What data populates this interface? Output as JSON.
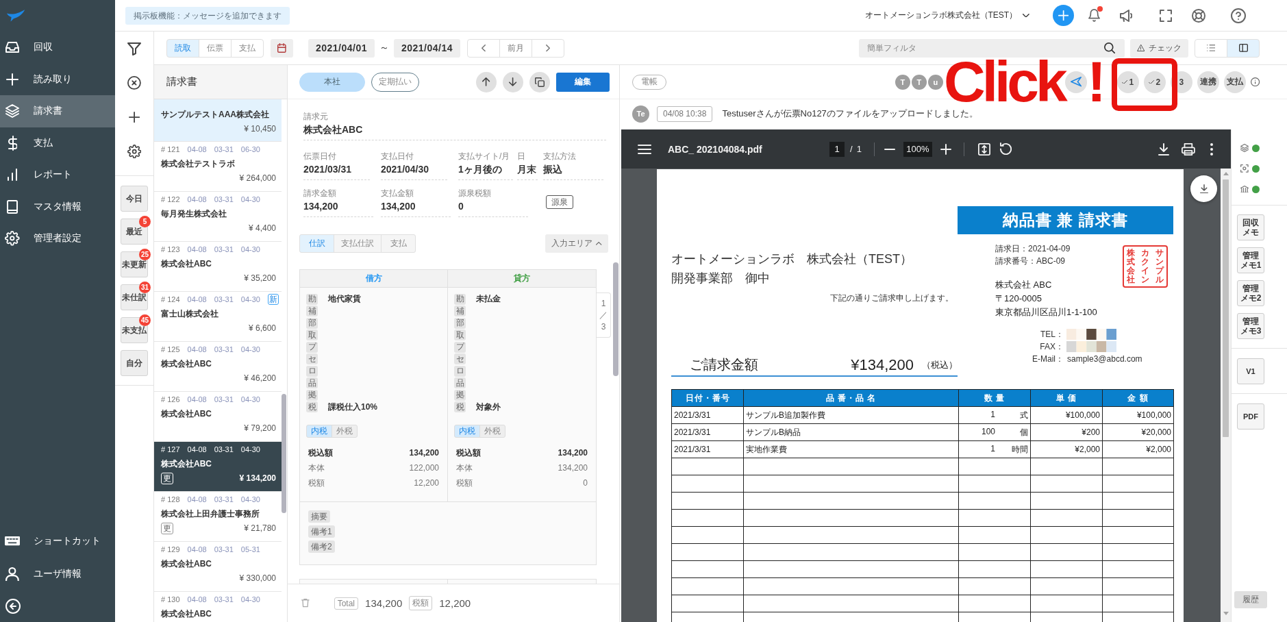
{
  "sidebar": {
    "items": [
      {
        "label": "回収",
        "selected": false
      },
      {
        "label": "読み取り",
        "selected": false
      },
      {
        "label": "請求書",
        "selected": true
      },
      {
        "label": "支払",
        "selected": false
      },
      {
        "label": "レポート",
        "selected": false
      },
      {
        "label": "マスタ情報",
        "selected": false
      },
      {
        "label": "管理者設定",
        "selected": false
      }
    ],
    "bottom_items": [
      {
        "label": "ショートカット"
      },
      {
        "label": "ユーザ情報"
      }
    ]
  },
  "top_bar": {
    "notice": "掲示板機能：メッセージを追加できます",
    "company": "オートメーションラボ株式会社（TEST）",
    "unread": true
  },
  "quick_filters": [
    {
      "label": "今日"
    },
    {
      "label": "最近",
      "count": "5"
    },
    {
      "label": "未更新",
      "count": "25"
    },
    {
      "label": "未仕訳",
      "count": "31"
    },
    {
      "label": "未支払",
      "count": "45"
    },
    {
      "label": "自分"
    }
  ],
  "toolbar": {
    "modes": [
      {
        "label": "読取",
        "selected": true
      },
      {
        "label": "伝票",
        "selected": false
      },
      {
        "label": "支払",
        "selected": false
      }
    ],
    "date_from": "2021/04/01",
    "range_separator": "～",
    "date_to": "2021/04/14",
    "month_button": "前月",
    "search": {
      "placeholder": "簡単フィルタ"
    },
    "check_button": "チェック",
    "views": [
      {
        "selected": false
      },
      {
        "selected": true
      }
    ]
  },
  "invoice_list": {
    "title": "請求書",
    "rows": [
      {
        "name": "サンプルテストAAA株式会社",
        "amount": "¥ 10,450",
        "selected": false,
        "highlighted": true
      },
      {
        "number": "# 121",
        "dates": [
          "04-08",
          "03-31",
          "06-30"
        ],
        "name": "株式会社テストラボ",
        "amount": "¥ 264,000",
        "selected": false,
        "highlighted": false
      },
      {
        "number": "# 122",
        "dates": [
          "04-08",
          "03-31",
          "04-30"
        ],
        "name": "毎月発生株式会社",
        "amount": "¥ 4,400",
        "selected": false,
        "highlighted": false
      },
      {
        "number": "# 123",
        "dates": [
          "04-08",
          "03-31",
          "04-30"
        ],
        "name": "株式会社ABC",
        "amount": "¥ 35,200",
        "selected": false,
        "highlighted": false
      },
      {
        "number": "# 124",
        "dates": [
          "04-08",
          "03-31",
          "04-30"
        ],
        "badge": "新",
        "name": "富士山株式会社",
        "amount": "¥ 6,600",
        "selected": false,
        "highlighted": false
      },
      {
        "number": "# 125",
        "dates": [
          "04-08",
          "03-31",
          "04-30"
        ],
        "name": "株式会社ABC",
        "amount": "¥ 46,200",
        "selected": false,
        "highlighted": false
      },
      {
        "number": "# 126",
        "dates": [
          "04-08",
          "03-31",
          "04-30"
        ],
        "name": "株式会社ABC",
        "amount": "¥ 79,200",
        "selected": false,
        "highlighted": false
      },
      {
        "number": "# 127",
        "dates": [
          "04-08",
          "03-31",
          "04-30"
        ],
        "name": "株式会社ABC",
        "tag": "更",
        "amount": "¥ 134,200",
        "selected": true,
        "highlighted": false
      },
      {
        "number": "# 128",
        "dates": [
          "04-08",
          "03-31",
          "04-30"
        ],
        "name": "株式会社上田弁護士事務所",
        "tag": "更",
        "amount": "¥ 21,780",
        "selected": false,
        "highlighted": false
      },
      {
        "number": "# 129",
        "dates": [
          "04-08",
          "03-31",
          "05-31"
        ],
        "name": "株式会社ABC",
        "amount": "¥ 330,000",
        "selected": false,
        "highlighted": false
      },
      {
        "number": "# 130",
        "dates": [
          "04-08",
          "03-31",
          "04-30"
        ],
        "name": "株式会社ABC",
        "selected": false,
        "highlighted": false
      }
    ]
  },
  "detail": {
    "chips": [
      {
        "label": "本社",
        "selected": true
      },
      {
        "label": "定期払い",
        "selected": false
      }
    ],
    "edit_button": "編集",
    "payee": {
      "label": "請求元",
      "value": "株式会社ABC"
    },
    "dates": [
      {
        "label": "伝票日付",
        "value": "2021/03/31"
      },
      {
        "label": "支払日付",
        "value": "2021/04/30"
      },
      {
        "label": "支払サイト/月",
        "value": "1ヶ月後の"
      },
      {
        "label": "日",
        "value": "月末"
      },
      {
        "label": "支払方法",
        "value": "振込"
      }
    ],
    "amounts": [
      {
        "label": "請求金額",
        "value": "134,200"
      },
      {
        "label": "支払金額",
        "value": "134,200"
      },
      {
        "label": "源泉税額",
        "value": "0"
      }
    ],
    "withholding_button": "源泉",
    "tabs": [
      {
        "label": "仕訳",
        "selected": true
      },
      {
        "label": "支払仕訳",
        "selected": false
      },
      {
        "label": "支払",
        "selected": false
      }
    ],
    "input_area_button": "入力エリア",
    "journal": [
      {
        "title": "借方",
        "color": "#2196f3",
        "lines": [
          {
            "tag": "勘",
            "value": "地代家賃"
          },
          {
            "tag": "補"
          },
          {
            "tag": "部"
          },
          {
            "tag": "取"
          },
          {
            "tag": "プ"
          },
          {
            "tag": "セ"
          },
          {
            "tag": "ロ"
          },
          {
            "tag": "品"
          },
          {
            "tag": "拠"
          },
          {
            "tag": "税",
            "value": "課税仕入10%"
          }
        ],
        "tax_modes": [
          {
            "label": "内税",
            "selected": true
          },
          {
            "label": "外税",
            "selected": false
          }
        ],
        "totals": [
          {
            "label": "税込額",
            "value": "134,200"
          },
          {
            "label": "本体",
            "value": "122,000"
          },
          {
            "label": "税額",
            "value": "12,200"
          }
        ]
      },
      {
        "title": "貸方",
        "color": "#43a047",
        "lines": [
          {
            "tag": "勘",
            "value": "未払金"
          },
          {
            "tag": "補"
          },
          {
            "tag": "部"
          },
          {
            "tag": "取"
          },
          {
            "tag": "プ"
          },
          {
            "tag": "セ"
          },
          {
            "tag": "ロ"
          },
          {
            "tag": "品"
          },
          {
            "tag": "拠"
          },
          {
            "tag": "税",
            "value": "対象外"
          }
        ],
        "tax_modes": [
          {
            "label": "内税",
            "selected": true
          },
          {
            "label": "外税",
            "selected": false
          }
        ],
        "totals": [
          {
            "label": "税込額",
            "value": "134,200"
          },
          {
            "label": "本体",
            "value": "134,200"
          },
          {
            "label": "税額",
            "value": "0"
          }
        ]
      }
    ],
    "page_indicator": {
      "current": "1",
      "separator": "／",
      "total": "3"
    },
    "remarks": [
      "摘要",
      "備考1",
      "備考2"
    ],
    "footer": {
      "total_label": "Total",
      "total": "134,200",
      "tax_label": "税額",
      "tax": "12,200"
    }
  },
  "viewer": {
    "ledger_tag": "電帳",
    "avatars": [
      "T",
      "T",
      "u"
    ],
    "steps": [
      {
        "kind": "arrow"
      },
      {
        "kind": "check",
        "label": "1"
      },
      {
        "kind": "check",
        "label": "2"
      },
      {
        "kind": "label",
        "label": "3"
      },
      {
        "kind": "label",
        "label": "連携"
      },
      {
        "kind": "label",
        "label": "支払"
      }
    ],
    "log": {
      "avatar": "Te",
      "time": "04/08 10:38",
      "message": "Testuserさんが伝票No127のファイルをアップロードしました。"
    },
    "pdf": {
      "filename": "ABC_ 202104084.pdf",
      "page": "1",
      "page_separator": "/",
      "page_count": "1",
      "zoom": "100%"
    },
    "document": {
      "title": "納品書 兼 請求書",
      "recipient": [
        "オートメーションラボ　株式会社（TEST）",
        "開発事業部　御中"
      ],
      "intro": "下記の通りご請求申し上げます。",
      "meta": [
        "請求日：2021-04-09",
        "請求番号：ABC-09"
      ],
      "stamp": [
        "株式会社",
        "カクイン",
        "サンプル"
      ],
      "issuer": [
        "株式会社 ABC",
        "〒120-0005",
        "東京都品川区品川1-1-100"
      ],
      "contacts": [
        {
          "label": "TEL：",
          "kind": "mosaic"
        },
        {
          "label": "FAX：",
          "kind": "mosaic"
        },
        {
          "label": "E-Mail：",
          "kind": "text",
          "value": "sample3@abcd.com"
        }
      ],
      "total": {
        "label": "ご請求金額",
        "amount": "¥134,200",
        "note": "（税込）"
      },
      "table": {
        "columns": [
          "日付・番号",
          "品 番・品 名",
          "数 量",
          "単 価",
          "金 額"
        ],
        "rows": [
          {
            "date": "2021/3/31",
            "item": "サンプルB追加製作費",
            "qty": "1",
            "unit": "式",
            "price": "¥100,000",
            "amount": "¥100,000"
          },
          {
            "date": "2021/3/31",
            "item": "サンプルB納品",
            "qty": "100",
            "unit": "個",
            "price": "¥200",
            "amount": "¥20,000"
          },
          {
            "date": "2021/3/31",
            "item": "実地作業費",
            "qty": "1",
            "unit": "時間",
            "price": "¥2,000",
            "amount": "¥2,000"
          }
        ]
      }
    },
    "rail": {
      "status": [
        {
          "ok": true
        },
        {
          "ok": true
        },
        {
          "ok": true
        }
      ],
      "memo_buttons": [
        [
          "回収",
          "メモ"
        ],
        [
          "管理",
          "メモ1"
        ],
        [
          "管理",
          "メモ2"
        ],
        [
          "管理",
          "メモ3"
        ]
      ],
      "version_button": "V1",
      "pdf_button": "PDF",
      "history_button": "履歴"
    }
  },
  "annotation": {
    "words": [
      "Click",
      "!"
    ]
  }
}
